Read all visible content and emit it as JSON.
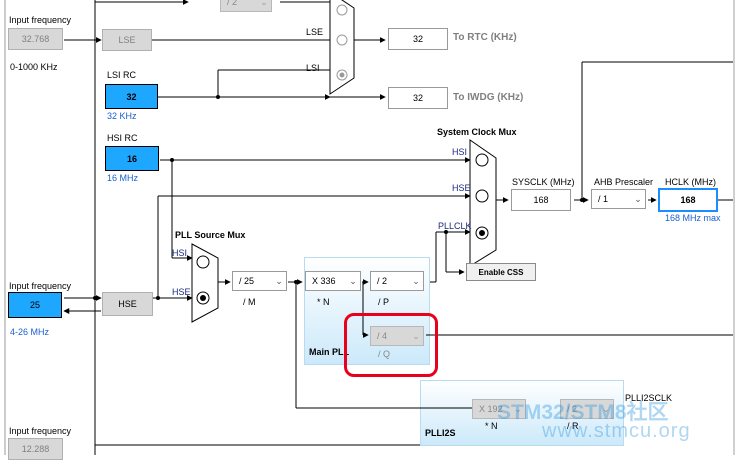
{
  "left_column": {
    "lse_input_label": "Input frequency",
    "lse_input_value": "32.768",
    "lse_range": "0-1000 KHz",
    "lsi_title": "LSI RC",
    "lsi_value": "32",
    "lsi_unit": "32 KHz",
    "hsi_title": "HSI RC",
    "hsi_value": "16",
    "hsi_unit": "16 MHz",
    "hse_input_label": "Input frequency",
    "hse_input_value": "25",
    "hse_range": "4-26 MHz",
    "i2s_input_label": "Input frequency",
    "i2s_input_value": "12.288"
  },
  "blocks": {
    "lse": "LSE",
    "hse": "HSE",
    "top_divider": "/ 2",
    "rtc_mux": {
      "inputs": [
        "LSE",
        "LSI"
      ]
    },
    "rtc_value": "32",
    "rtc_label": "To RTC (KHz)",
    "iwdg_value": "32",
    "iwdg_label": "To IWDG (KHz)",
    "sys_mux_title": "System Clock Mux",
    "sys_mux_inputs": [
      "HSI",
      "HSE",
      "PLLCLK"
    ],
    "sysclk_label": "SYSCLK (MHz)",
    "sysclk_value": "168",
    "ahb_label": "AHB Prescaler",
    "ahb_value": "/ 1",
    "hclk_label": "HCLK (MHz)",
    "hclk_value": "168",
    "hclk_max": "168 MHz max",
    "enable_css": "Enable CSS",
    "pll_src_title": "PLL Source Mux",
    "pll_src_inputs": [
      "HSI",
      "HSE"
    ],
    "pllm_value": "/ 25",
    "pllm_label": "/ M",
    "plln_value": "X 336",
    "plln_label": "* N",
    "pllp_value": "/ 2",
    "pllp_label": "/ P",
    "pllq_value": "/ 4",
    "pllq_label": "/ Q",
    "main_pll_label": "Main PLL",
    "plli2s_label": "PLLI2S",
    "plli2sclk_label": "PLLI2SCLK",
    "plli2sn_value": "X 192",
    "plli2sn_label": "* N",
    "plli2sr_value": "/ 2",
    "plli2sr_label": "/ R"
  },
  "watermark": {
    "line1": "STM32/STM8社区",
    "line2": "www.stmcu.org"
  },
  "colors": {
    "input_cyan": "#1ea7ff",
    "hclk_border": "#1e8cff",
    "highlight_red": "#e8001c",
    "pll_panel": "#cce9fa"
  }
}
